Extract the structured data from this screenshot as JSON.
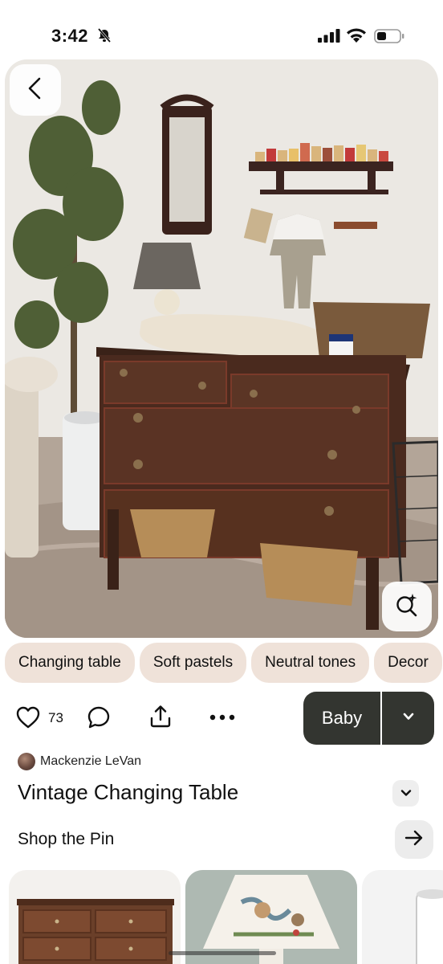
{
  "status_bar": {
    "time": "3:42",
    "icons": [
      "bell-slash-icon",
      "cellular-signal-icon",
      "wifi-icon",
      "battery-icon"
    ]
  },
  "hero": {
    "icons": [
      "back-arrow-icon",
      "visual-search-icon"
    ]
  },
  "chips": [
    "Changing table",
    "Soft pastels",
    "Neutral tones",
    "Decor"
  ],
  "actions": {
    "like_count": "73",
    "icons": [
      "heart-icon",
      "comment-icon",
      "share-icon",
      "more-icon"
    ]
  },
  "board": {
    "name": "Baby",
    "dropdown_icon": "chevron-down-icon"
  },
  "author": {
    "name": "Mackenzie LeVan"
  },
  "pin": {
    "title": "Vintage Changing Table"
  },
  "shop": {
    "label": "Shop the Pin",
    "arrow_icon": "arrow-right-icon"
  },
  "colors": {
    "chip_bg": "#efe2d9",
    "board_button_bg": "#333530",
    "icon_button_bg": "#ececec"
  }
}
